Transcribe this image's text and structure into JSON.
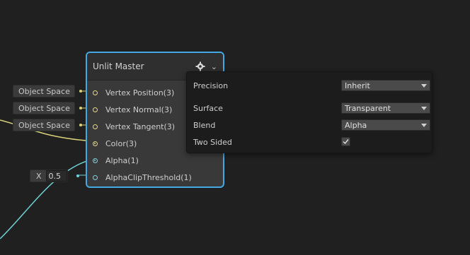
{
  "node": {
    "title": "Unlit Master",
    "ports": [
      {
        "label": "Vertex Position(3)",
        "color": "#e0da85",
        "connected": false
      },
      {
        "label": "Vertex Normal(3)",
        "color": "#e0da85",
        "connected": false
      },
      {
        "label": "Vertex Tangent(3)",
        "color": "#e0da85",
        "connected": false
      },
      {
        "label": "Color(3)",
        "color": "#e0da85",
        "connected": true
      },
      {
        "label": "Alpha(1)",
        "color": "#7fd7dc",
        "connected": true
      },
      {
        "label": "AlphaClipThreshold(1)",
        "color": "#7fd7dc",
        "connected": false
      }
    ],
    "border_color": "#44a8e3"
  },
  "inputs": {
    "vertex_position": "Object Space",
    "vertex_normal": "Object Space",
    "vertex_tangent": "Object Space",
    "alpha_clip_label": "X",
    "alpha_clip_value": "0.5"
  },
  "settings": {
    "precision_label": "Precision",
    "precision_value": "Inherit",
    "surface_label": "Surface",
    "surface_value": "Transparent",
    "blend_label": "Blend",
    "blend_value": "Alpha",
    "two_sided_label": "Two Sided",
    "two_sided_checked": true
  },
  "icons": {
    "settings": "gear-icon",
    "collapse": "chevron-down-icon",
    "check": "checkmark-icon"
  }
}
